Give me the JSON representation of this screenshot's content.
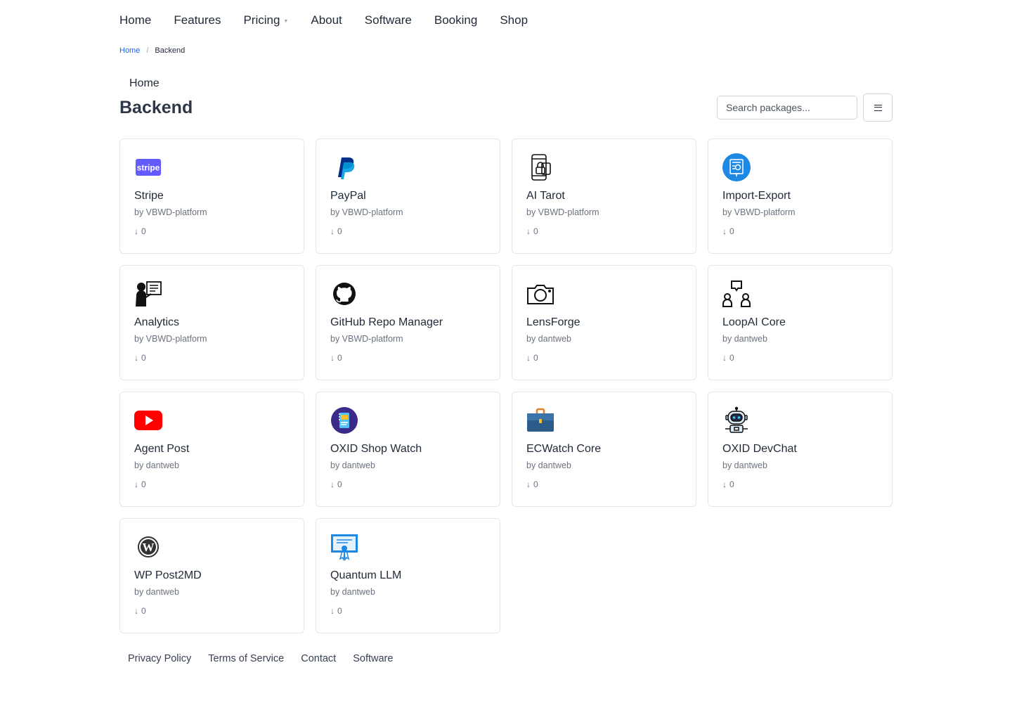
{
  "nav": {
    "items": [
      "Home",
      "Features",
      "Pricing",
      "About",
      "Software",
      "Booking",
      "Shop"
    ]
  },
  "breadcrumb": {
    "home": "Home",
    "separator": "/",
    "current": "Backend"
  },
  "header": {
    "home_label": "Home",
    "title": "Backend"
  },
  "search": {
    "placeholder": "Search packages..."
  },
  "packages": [
    {
      "name": "Stripe",
      "author": "by VBWD-platform",
      "downloads": "0",
      "icon": "stripe-icon"
    },
    {
      "name": "PayPal",
      "author": "by VBWD-platform",
      "downloads": "0",
      "icon": "paypal-icon"
    },
    {
      "name": "AI Tarot",
      "author": "by VBWD-platform",
      "downloads": "0",
      "icon": "phone-lock-icon"
    },
    {
      "name": "Import-Export",
      "author": "by VBWD-platform",
      "downloads": "0",
      "icon": "import-export-icon"
    },
    {
      "name": "Analytics",
      "author": "by VBWD-platform",
      "downloads": "0",
      "icon": "presenter-board-icon"
    },
    {
      "name": "GitHub Repo Manager",
      "author": "by VBWD-platform",
      "downloads": "0",
      "icon": "github-icon"
    },
    {
      "name": "LensForge",
      "author": "by dantweb",
      "downloads": "0",
      "icon": "camera-icon"
    },
    {
      "name": "LoopAI Core",
      "author": "by dantweb",
      "downloads": "0",
      "icon": "people-chat-icon"
    },
    {
      "name": "Agent Post",
      "author": "by dantweb",
      "downloads": "0",
      "icon": "youtube-icon"
    },
    {
      "name": "OXID Shop Watch",
      "author": "by dantweb",
      "downloads": "0",
      "icon": "notebook-icon"
    },
    {
      "name": "ECWatch Core",
      "author": "by dantweb",
      "downloads": "0",
      "icon": "briefcase-icon"
    },
    {
      "name": "OXID DevChat",
      "author": "by dantweb",
      "downloads": "0",
      "icon": "robot-icon"
    },
    {
      "name": "WP Post2MD",
      "author": "by dantweb",
      "downloads": "0",
      "icon": "wordpress-icon"
    },
    {
      "name": "Quantum LLM",
      "author": "by dantweb",
      "downloads": "0",
      "icon": "certificate-board-icon"
    }
  ],
  "footer": {
    "links": [
      "Privacy Policy",
      "Terms of Service",
      "Contact",
      "Software"
    ]
  },
  "colors": {
    "link": "#2563eb",
    "title": "#2d3748",
    "muted": "#6b7280",
    "border": "#e5e7eb"
  }
}
